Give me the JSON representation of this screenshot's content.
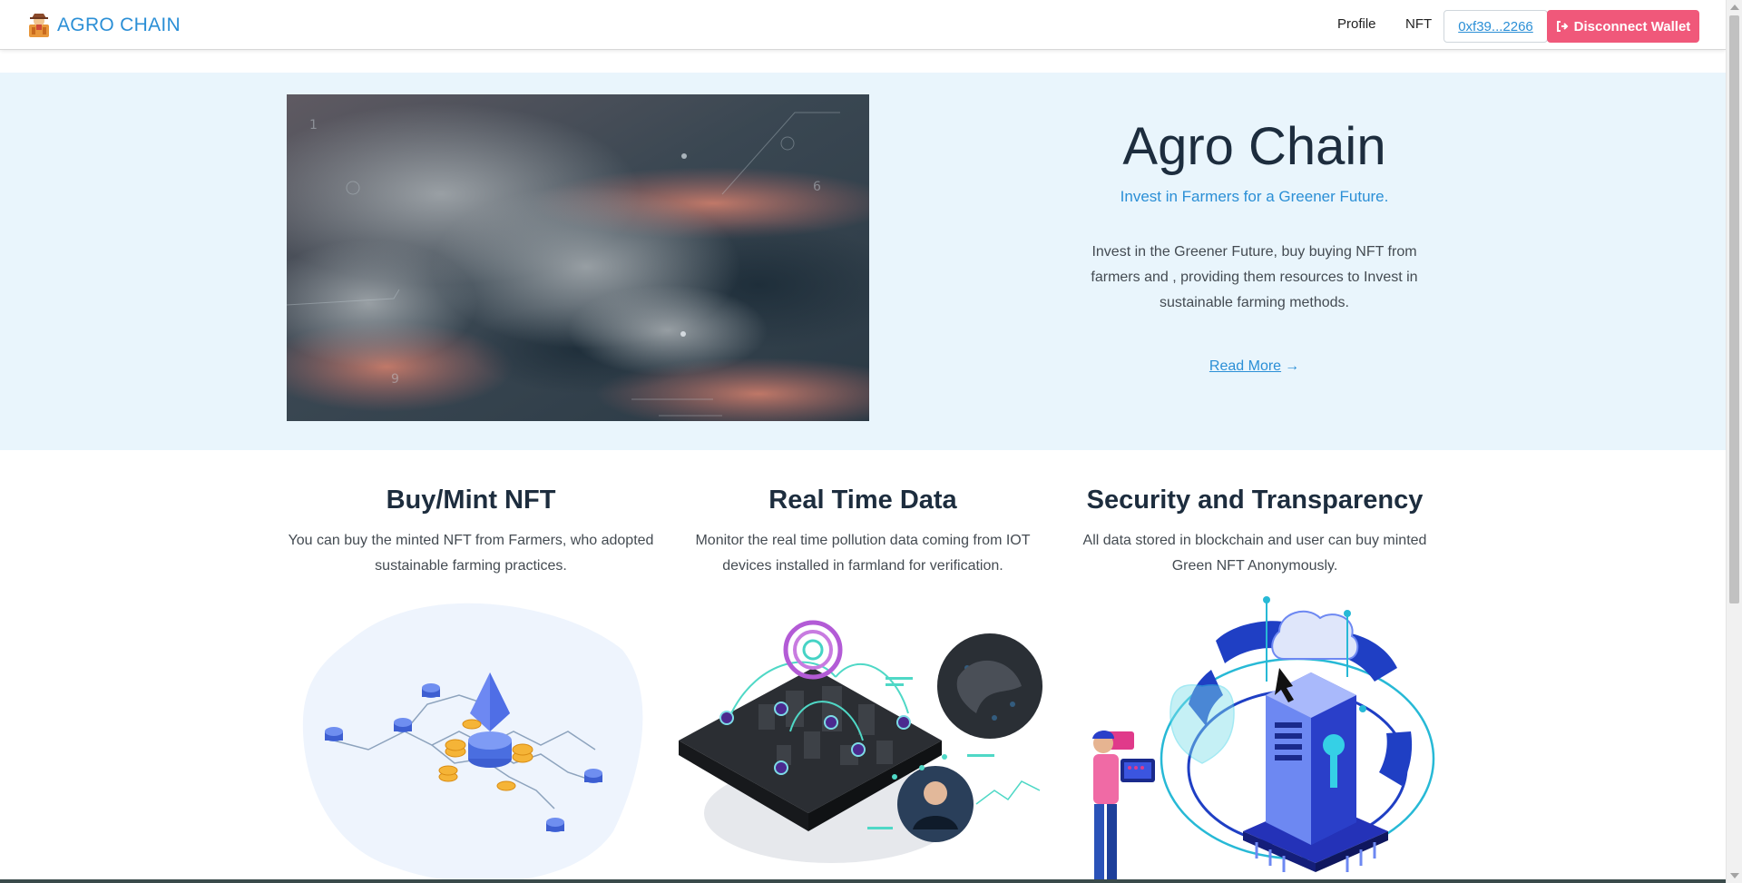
{
  "nav": {
    "brand": "AGRO CHAIN",
    "links": [
      "Profile",
      "NFT"
    ],
    "wallet_address": "0xf39...2266",
    "disconnect_label": "Disconnect Wallet"
  },
  "hero": {
    "title": "Agro Chain",
    "subtitle": "Invest in Farmers for a Greener Future.",
    "description": "Invest in the Greener Future, buy buying NFT from farmers and , providing them resources to Invest in sustainable farming methods.",
    "read_more": "Read More"
  },
  "features": [
    {
      "title": "Buy/Mint NFT",
      "text": "You can buy the minted NFT from Farmers, who adopted sustainable farming practices."
    },
    {
      "title": "Real Time Data",
      "text": "Monitor the real time pollution data coming from IOT devices installed in farmland for verification."
    },
    {
      "title": "Security and Transparency",
      "text": "All data stored in blockchain and user can buy minted Green NFT Anonymously."
    }
  ],
  "colors": {
    "brand": "#2b8fd6",
    "hero_bg": "#e9f5fc",
    "heading": "#1d2d3e",
    "disconnect_bg": "#f0587a"
  },
  "icons": [
    "farmer-logo-icon",
    "sign-out-icon",
    "arrow-right-icon"
  ]
}
